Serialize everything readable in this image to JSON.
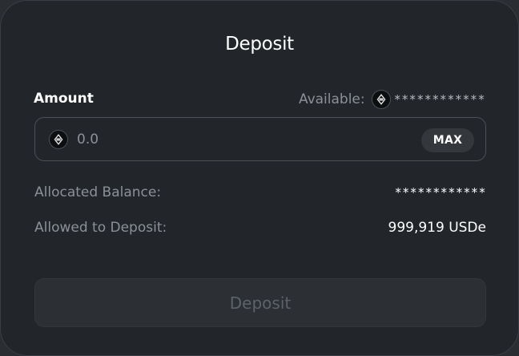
{
  "modal": {
    "title": "Deposit"
  },
  "amount": {
    "label": "Amount",
    "available_label": "Available:",
    "available_value": "************",
    "token_icon": "ethena-token-icon",
    "input_value": "",
    "input_placeholder": "0.0",
    "max_label": "MAX"
  },
  "balances": {
    "allocated_label": "Allocated Balance:",
    "allocated_value": "************",
    "allowed_label": "Allowed to Deposit:",
    "allowed_value": "999,919 USDe"
  },
  "actions": {
    "deposit_label": "Deposit"
  },
  "colors": {
    "background": "#22252a",
    "border": "#4b4f56",
    "text_primary": "#ffffff",
    "text_muted": "#8c9097",
    "button_disabled_bg": "#2c2f33",
    "button_disabled_text": "#5d6168"
  }
}
